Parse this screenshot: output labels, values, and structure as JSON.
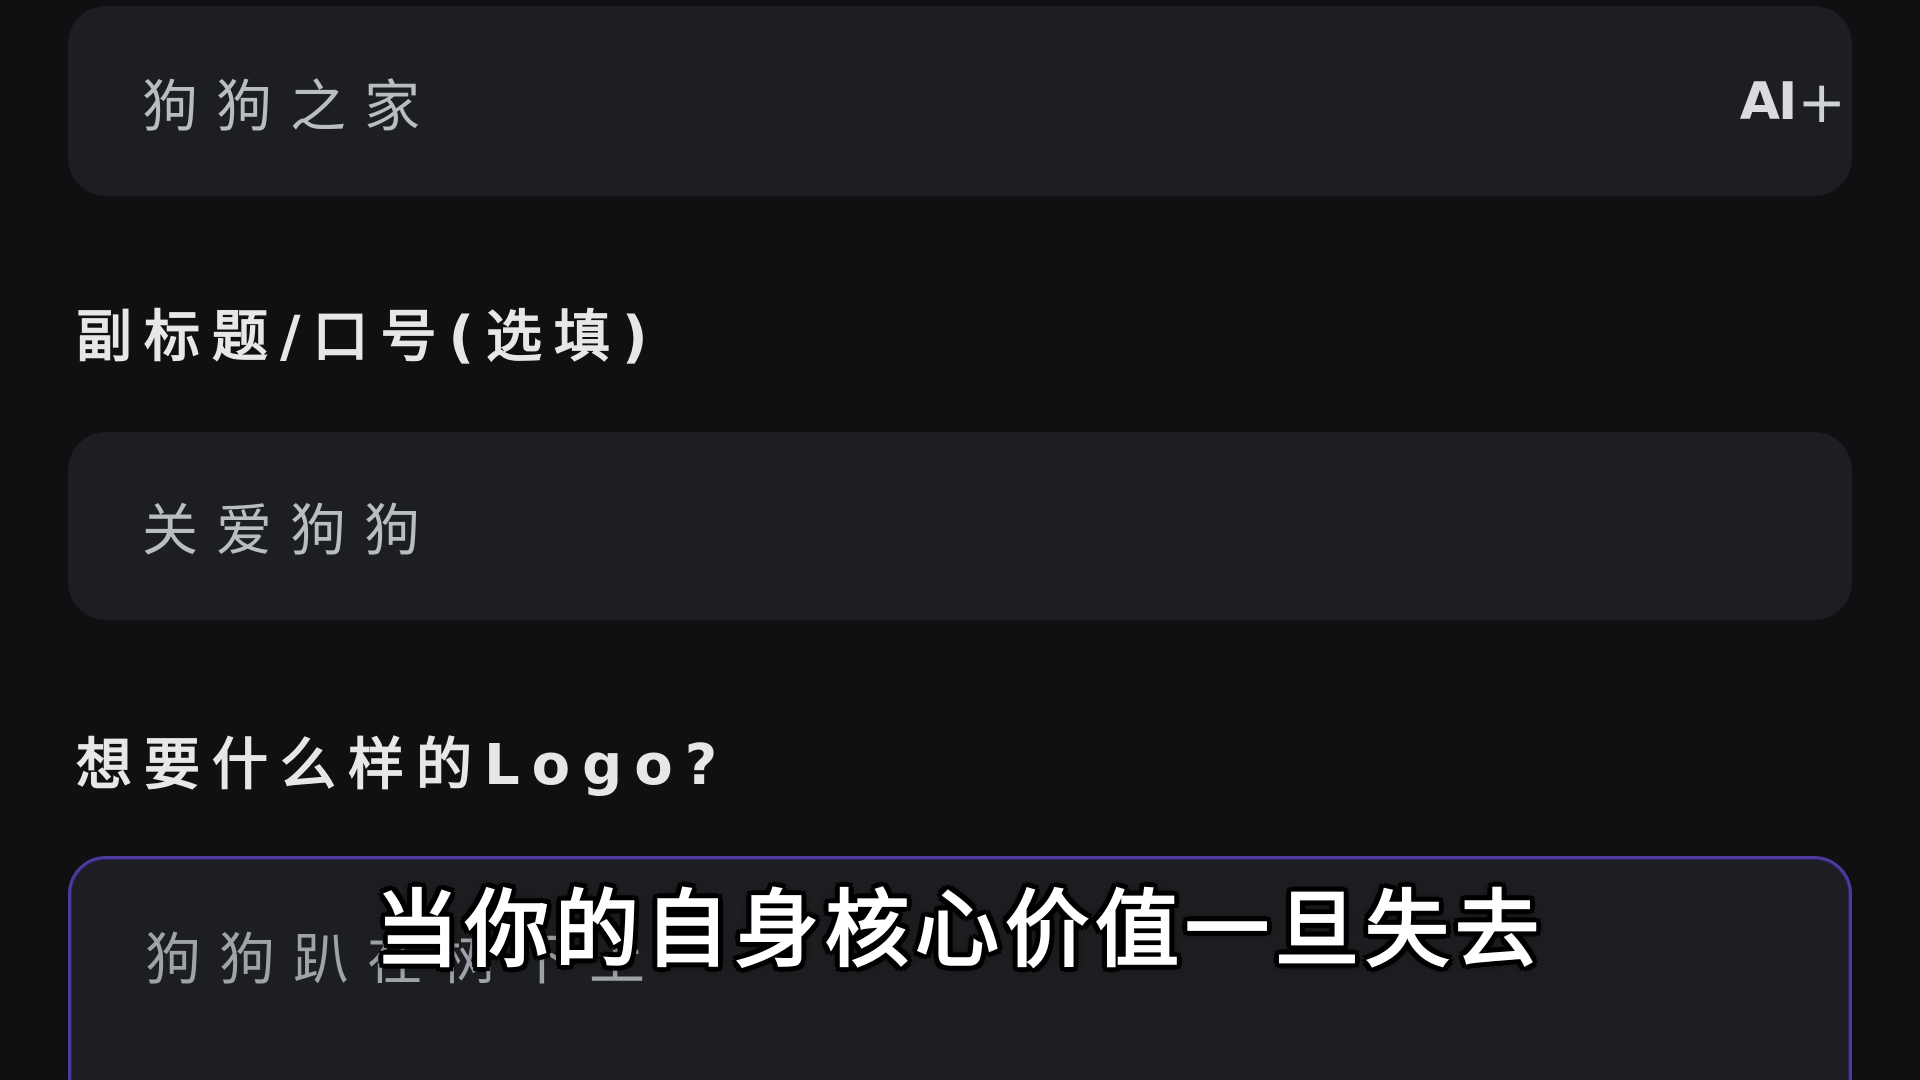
{
  "form": {
    "brand_name": {
      "value": "狗狗之家",
      "ai_button_label": "AI",
      "ai_button_symbol": "+"
    },
    "subtitle": {
      "label": "副标题/口号(选填)",
      "value": "关爱狗狗"
    },
    "logo_description": {
      "label": "想要什么样的Logo?",
      "value": "狗狗趴在树下上"
    }
  },
  "video_caption": "当你的自身核心价值一旦失去",
  "colors": {
    "background": "#0f1012",
    "field_background": "#1c1e21",
    "focused_border": "#4d3a9c",
    "label_text": "#e6e7e9",
    "value_text": "#b9bcc0"
  }
}
